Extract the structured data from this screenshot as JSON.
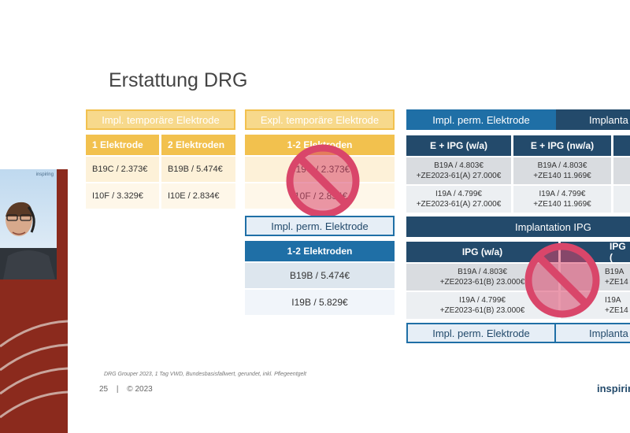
{
  "slide": {
    "title": "Erstattung DRG",
    "footer_note": "DRG Grouper 2023, 1 Tag VWD, Bundesbasisfallwert, gerundet, inkl. Pflegeentgelt",
    "page_number": "25",
    "separator": "|",
    "copyright": "© 2023",
    "logo_text": "inspirin"
  },
  "webcam": {
    "watermark": "inspiring"
  },
  "table_temp": {
    "header": "Impl. temporäre Elektrode",
    "col1": "1 Elektrode",
    "col2": "2 Elektroden",
    "rows": [
      [
        "B19C / 2.373€",
        "B19B / 5.474€"
      ],
      [
        "I10F / 3.329€",
        "I10E / 2.834€"
      ]
    ]
  },
  "table_expl": {
    "header": "Expl. temporäre Elektrode",
    "subheader": "1-2 Elektroden",
    "rows": [
      "B19C / 2.373€",
      "I10F / 2.834€"
    ],
    "overlay": "prohibited-icon"
  },
  "table_perm_small": {
    "header": "Impl. perm. Elektrode",
    "subheader": "1-2 Elektroden",
    "rows": [
      "B19B / 5.474€",
      "I19B / 5.829€"
    ]
  },
  "table_right_top": {
    "header_a": "Impl. perm. Elektrode",
    "header_b": "Implanta",
    "col1": "E + IPG (w/a)",
    "col2": "E + IPG (nw/a)",
    "rows": [
      [
        "B19A / 4.803€\n+ZE2023-61(A) 27.000€",
        "B19A / 4.803€\n+ZE140 11.969€"
      ],
      [
        "I19A / 4.799€\n+ZE2023-61(A) 27.000€",
        "I19A / 4.799€\n+ZE140 11.969€"
      ]
    ]
  },
  "table_right_mid": {
    "header": "Implantation IPG",
    "col1": "IPG (w/a)",
    "col2": "IPG (",
    "rows": [
      [
        "B19A / 4.803€\n+ZE2023-61(B) 23.000€",
        "B19A\n+ZE14"
      ],
      [
        "I19A / 4.799€\n+ZE2023-61(B) 23.000€",
        "I19A\n+ZE14"
      ]
    ],
    "overlay": "prohibited-icon"
  },
  "table_right_bottom": {
    "header_a": "Impl. perm. Elektrode",
    "header_b": "Implanta"
  },
  "colors": {
    "yellow": "#f2c14e",
    "blue": "#1f6fa6",
    "navy": "#234a6b",
    "prohibit_red": "#d9466a",
    "webcam_bg": "#8b2a1d"
  }
}
